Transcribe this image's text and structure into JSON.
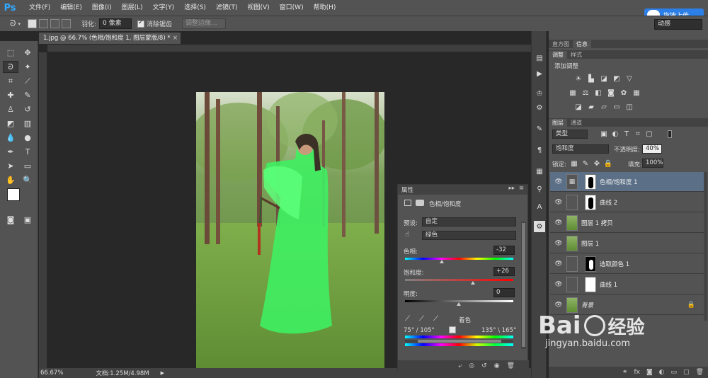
{
  "app": {
    "logo": "Ps",
    "menu": [
      "文件(F)",
      "编辑(E)",
      "图像(I)",
      "图层(L)",
      "文字(Y)",
      "选择(S)",
      "滤镜(T)",
      "视图(V)",
      "窗口(W)",
      "帮助(H)"
    ]
  },
  "upload_button": "拖拽上传",
  "options_bar": {
    "feather_label": "羽化:",
    "feather_value": "0 像素",
    "antialias_label": "消除锯齿",
    "refine_edge": "调整边缘...",
    "workspace": "动感"
  },
  "document": {
    "tab_title": "1.jpg @ 66.7% (色相/饱和度 1, 图层蒙版/8) *",
    "zoom": "66.67%",
    "doc_size": "文档:1.25M/4.98M"
  },
  "properties": {
    "title": "属性",
    "header": "色相/饱和度",
    "preset_label": "预设:",
    "preset_value": "自定",
    "channel_value": "绿色",
    "hue_label": "色相:",
    "hue_value": "-32",
    "sat_label": "饱和度:",
    "sat_value": "+26",
    "light_label": "明度:",
    "light_value": "0",
    "colorize_label": "着色",
    "range_left": "75° / 105°",
    "range_right": "135° \\ 165°"
  },
  "panel_tabs": {
    "top": [
      "直方图",
      "信息"
    ],
    "adjust": [
      "调整",
      "样式"
    ],
    "layers_tabs": [
      "图层",
      "通道"
    ]
  },
  "adjustments": {
    "title": "添加调整"
  },
  "layers_panel": {
    "filter_kind": "类型",
    "blend_mode": "饱和度",
    "opacity_label": "不透明度:",
    "opacity_value": "40%",
    "lock_label": "锁定:",
    "fill_label": "填充:",
    "fill_value": "100%",
    "layers": [
      {
        "name": "色相/饱和度 1",
        "selected": true
      },
      {
        "name": "曲线 2",
        "selected": false
      },
      {
        "name": "图层 1 拷贝",
        "selected": false
      },
      {
        "name": "图层 1",
        "selected": false
      },
      {
        "name": "选取颜色 1",
        "selected": false
      },
      {
        "name": "曲线 1",
        "selected": false
      },
      {
        "name": "背景",
        "selected": false
      }
    ]
  },
  "watermark": {
    "brand": "Bai",
    "brand_cn": "经验",
    "url": "jingyan.baidu.com"
  }
}
